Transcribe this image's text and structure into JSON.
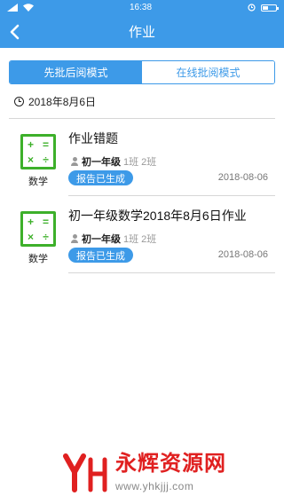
{
  "status_bar": {
    "time": "16:38",
    "battery_level": 0.45
  },
  "nav": {
    "back_icon": "chevron-left-icon",
    "title": "作业"
  },
  "tabs": [
    {
      "label": "先批后阅模式",
      "active": true
    },
    {
      "label": "在线批阅模式",
      "active": false
    }
  ],
  "date_header": {
    "icon": "clock-icon",
    "text": "2018年8月6日"
  },
  "homework": [
    {
      "subject_icon": "math-icon",
      "subject": "数学",
      "title": "作业错题",
      "grade": "初一年级",
      "classes": "1班 2班",
      "status": "报告已生成",
      "date": "2018-08-06"
    },
    {
      "subject_icon": "math-icon",
      "subject": "数学",
      "title": "初一年级数学2018年8月6日作业",
      "grade": "初一年级",
      "classes": "1班 2班",
      "status": "报告已生成",
      "date": "2018-08-06"
    }
  ],
  "watermark": {
    "title": "永辉资源网",
    "url": "www.yhkjjj.com"
  },
  "colors": {
    "primary": "#3d9ae8",
    "subject_green": "#3db02a",
    "watermark_red": "#e02020"
  }
}
